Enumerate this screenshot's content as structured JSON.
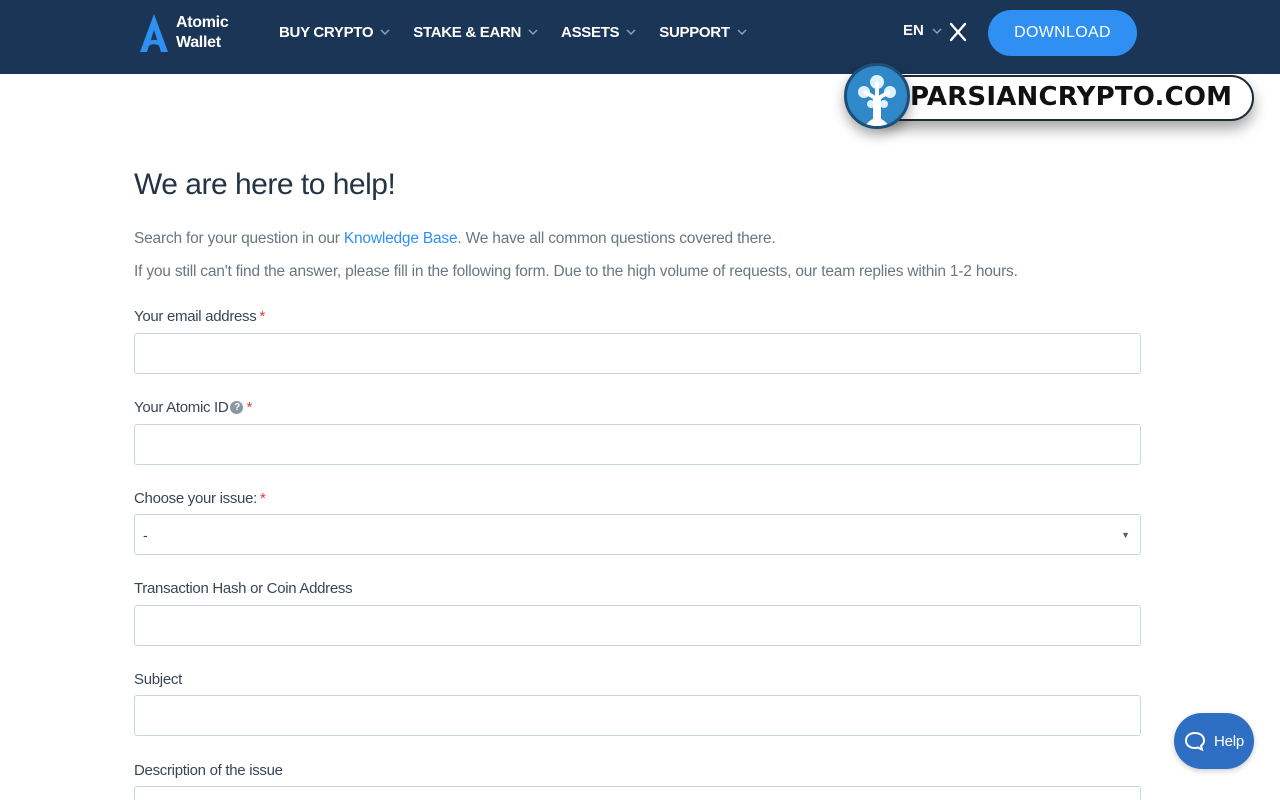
{
  "header": {
    "logo_line1": "Atomic",
    "logo_line2": "Wallet",
    "nav": [
      {
        "label": "BUY CRYPTO"
      },
      {
        "label": "STAKE & EARN"
      },
      {
        "label": "ASSETS"
      },
      {
        "label": "SUPPORT"
      }
    ],
    "language": "EN",
    "social_icon": "x-icon",
    "download_label": "DOWNLOAD"
  },
  "watermark": {
    "text": "PARSIANCRYPTO.COM"
  },
  "main": {
    "title": "We are here to help!",
    "intro_prefix": "Search for your question in our ",
    "intro_link": "Knowledge Base",
    "intro_suffix": ". We have all common questions covered there.",
    "intro_line2": "If you still can't find the answer, please fill in the following form. Due to the high volume of requests, our team replies within 1-2 hours."
  },
  "form": {
    "email_label": "Your email address",
    "email_value": "",
    "atomic_id_label": "Your Atomic ID",
    "atomic_id_value": "",
    "issue_label": "Choose your issue:",
    "issue_selected": "-",
    "tx_label": "Transaction Hash or Coin Address",
    "tx_value": "",
    "subject_label": "Subject",
    "subject_value": "",
    "description_label": "Description of the issue",
    "required_mark": "*",
    "info_mark": "?"
  },
  "help_widget": {
    "label": "Help"
  },
  "colors": {
    "header_bg": "#1b3557",
    "accent": "#2f8ff2",
    "help_bg": "#2f6fc3",
    "required": "#e23b3b",
    "field_border": "#c5d6e6"
  }
}
